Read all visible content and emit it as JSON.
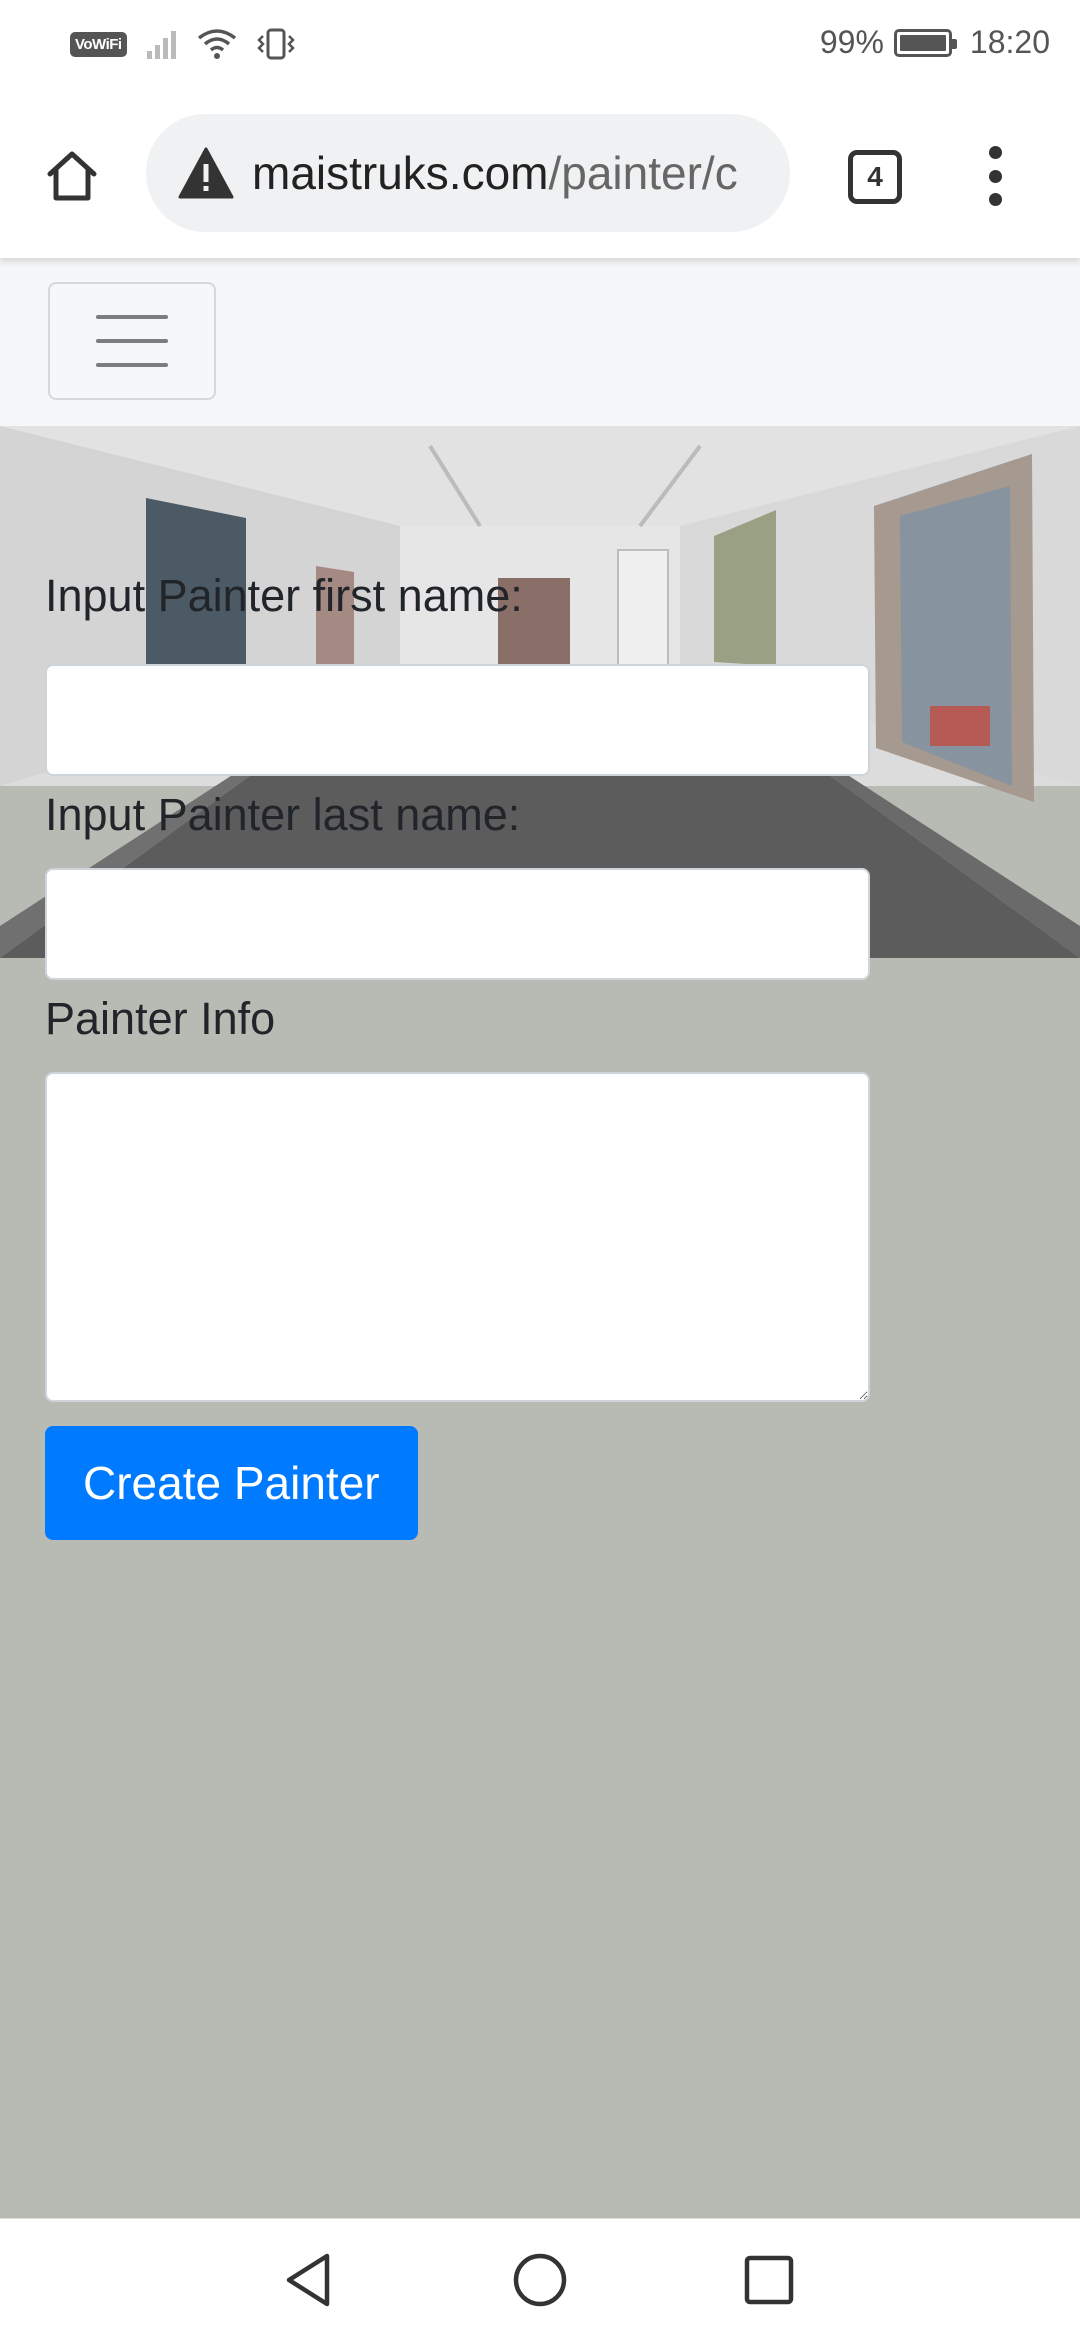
{
  "status_bar": {
    "vowifi": "VoWiFi",
    "battery_pct": "99%",
    "time": "18:20"
  },
  "browser": {
    "url_domain": "maistruks.com",
    "url_path": "/painter/c",
    "tab_count": "4"
  },
  "form": {
    "first_name_label": "Input Painter first name:",
    "first_name_value": "",
    "last_name_label": "Input Painter last name:",
    "last_name_value": "",
    "info_label": "Painter Info",
    "info_value": "",
    "submit_label": "Create Painter"
  },
  "colors": {
    "page_background": "#b8bab4",
    "button_primary": "#007bff",
    "navbar_bg": "#f6f7f8"
  }
}
